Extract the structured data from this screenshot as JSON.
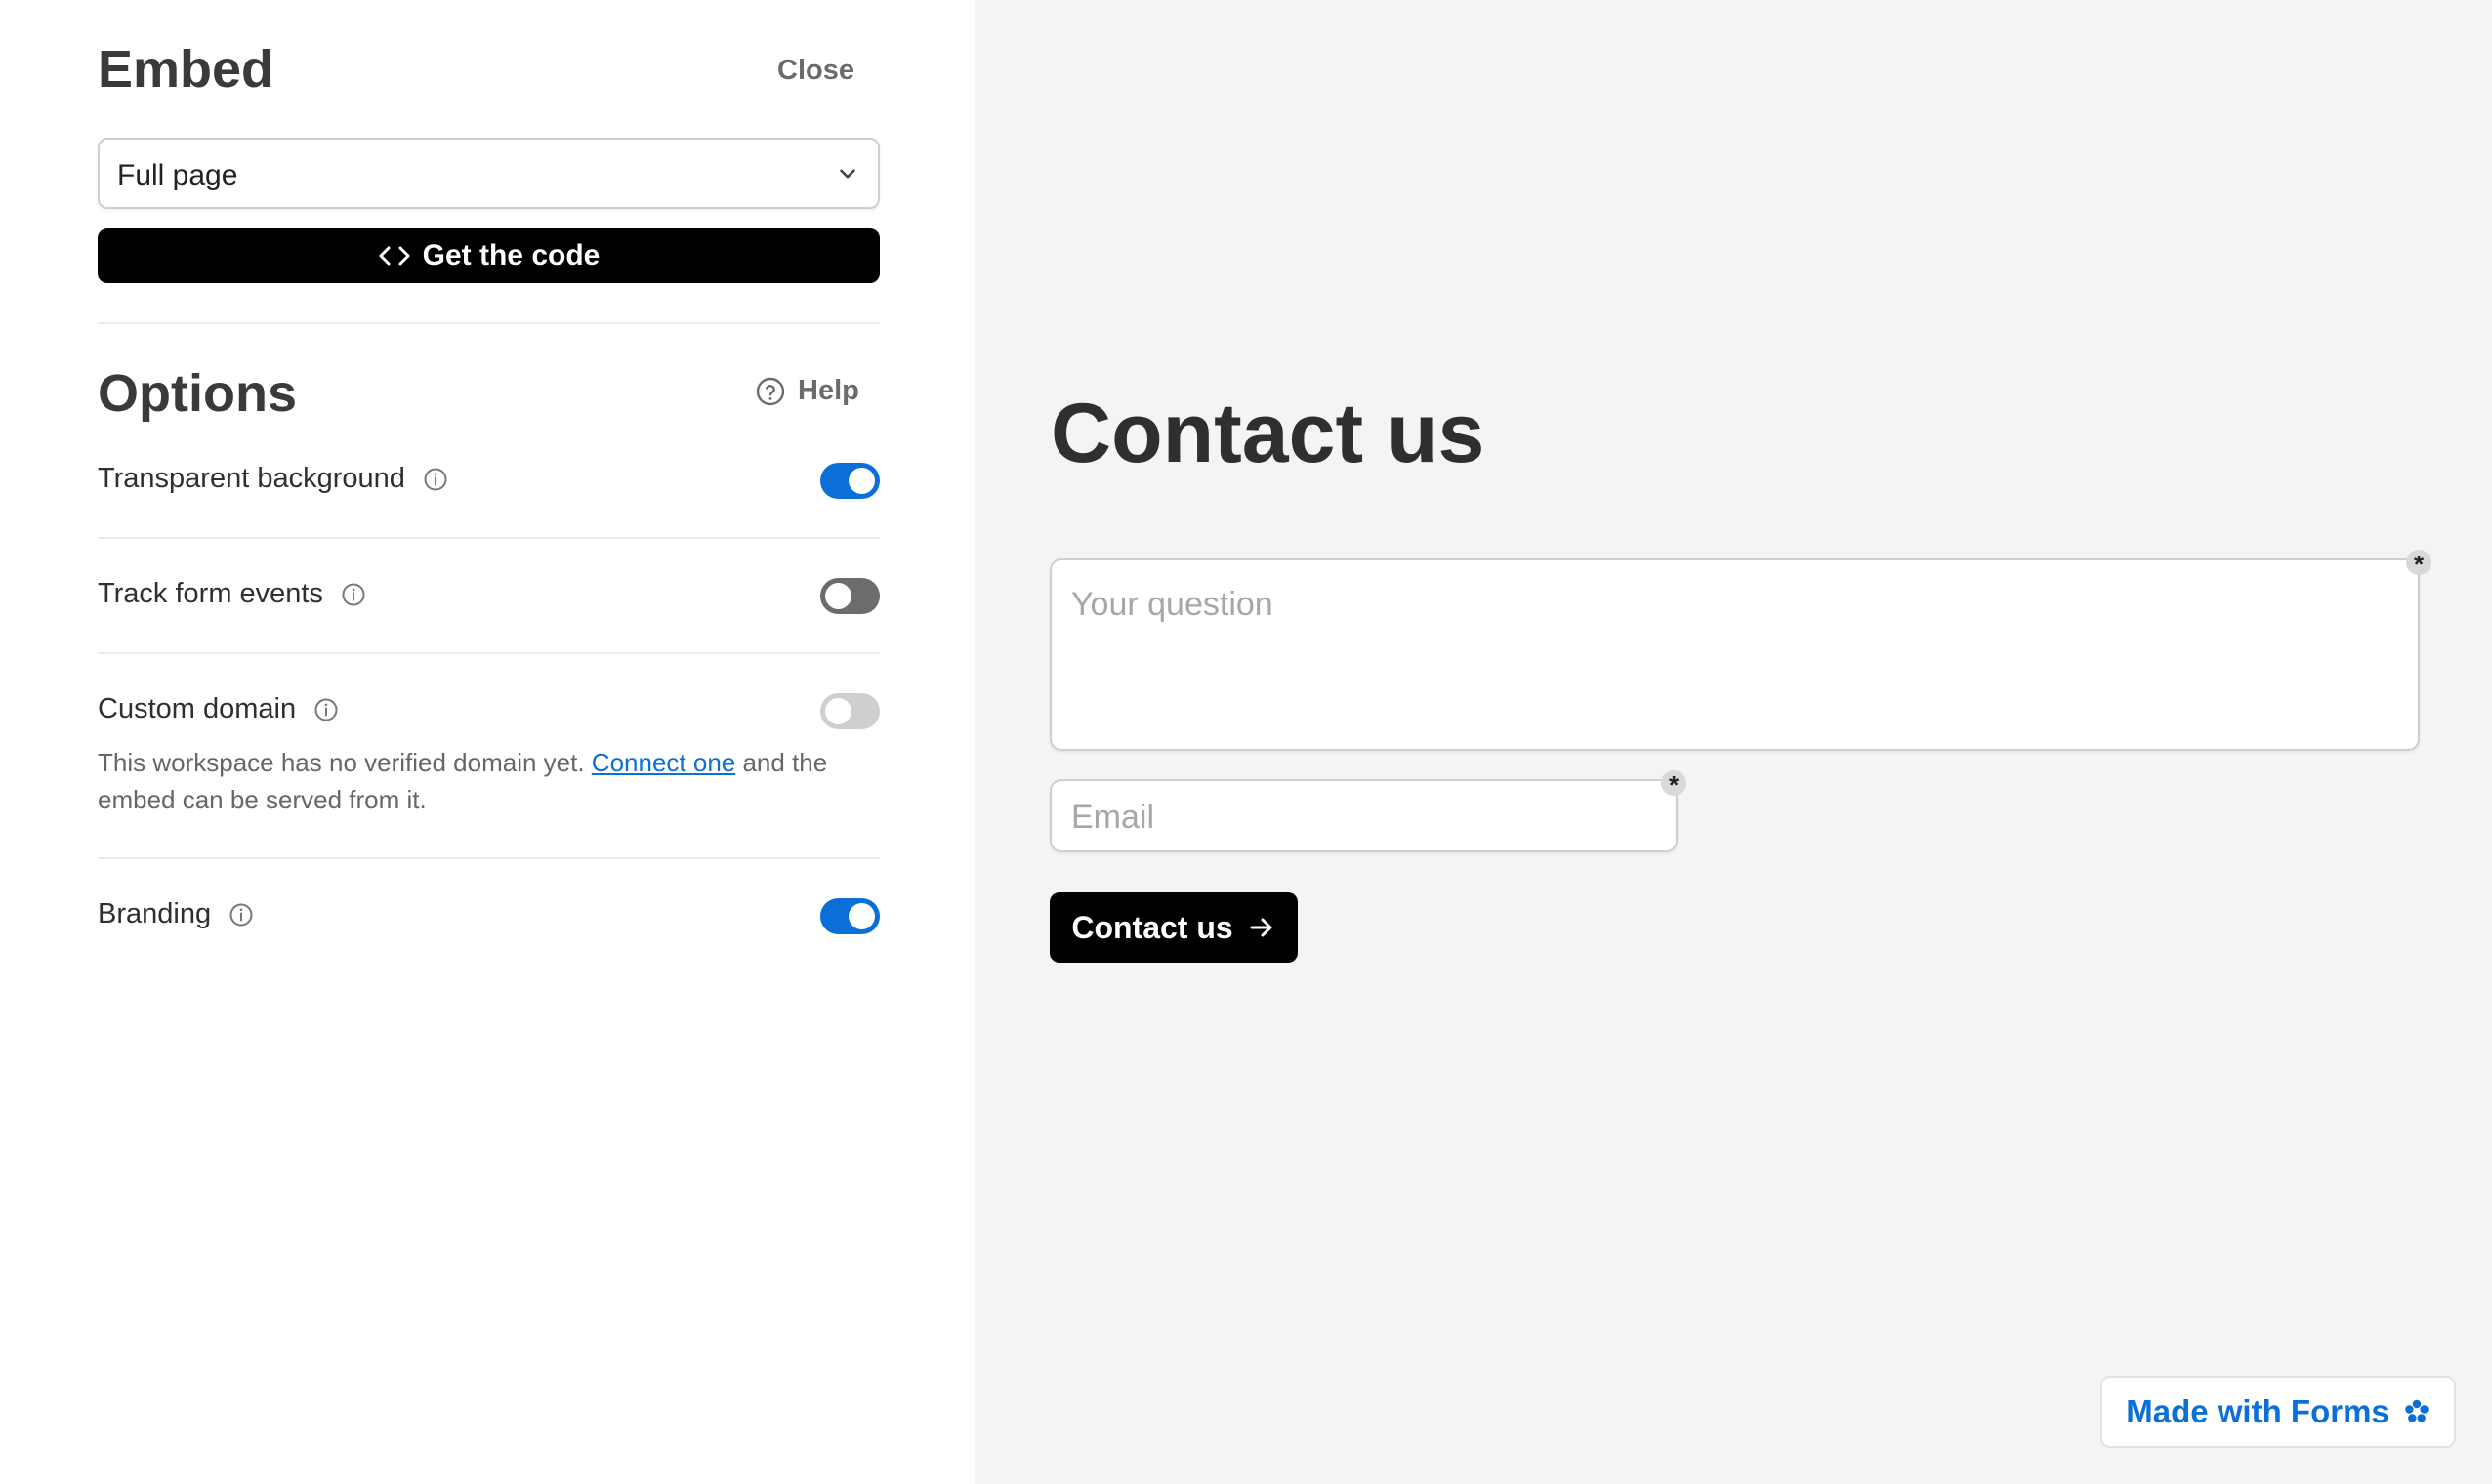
{
  "panel": {
    "title": "Embed",
    "close_label": "Close",
    "embed_type": {
      "selected": "Full page"
    },
    "get_code_label": "Get the code"
  },
  "options": {
    "title": "Options",
    "help_label": "Help",
    "items": [
      {
        "label": "Transparent background",
        "state": "on"
      },
      {
        "label": "Track form events",
        "state": "off"
      },
      {
        "label": "Custom domain",
        "state": "disabled",
        "description_before": "This workspace has no verified domain yet. ",
        "description_link": "Connect one",
        "description_after": " and the embed can be served from it."
      },
      {
        "label": "Branding",
        "state": "on"
      }
    ]
  },
  "preview": {
    "form_title": "Contact us",
    "question_placeholder": "Your question",
    "email_placeholder": "Email",
    "required_marker": "*",
    "submit_label": "Contact us",
    "badge_label": "Made with Forms"
  },
  "colors": {
    "accent": "#0b6fd8",
    "toggle_off": "#6c6c6c",
    "toggle_disabled": "#cfcfcf",
    "button": "#000000",
    "preview_bg": "#f4f4f4"
  }
}
